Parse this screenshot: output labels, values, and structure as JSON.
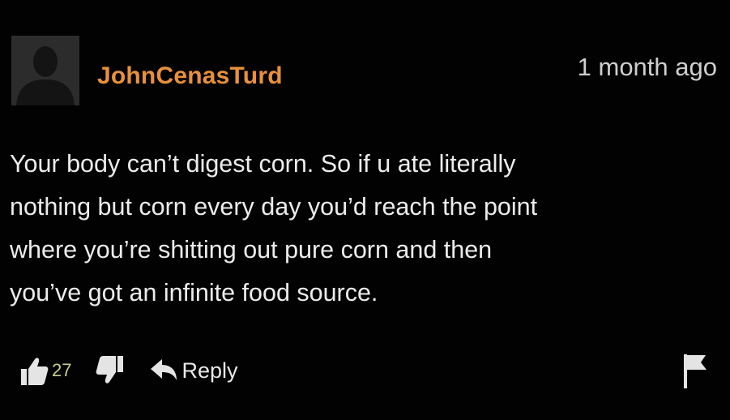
{
  "comment": {
    "username": "JohnCenasTurd",
    "timestamp": "1 month ago",
    "lines": [
      "Your body can’t digest corn. So if u ate literally",
      "nothing but corn every day you’d reach the point",
      "where you’re shitting out pure corn and then",
      "you’ve got an infinite food source."
    ],
    "likes": "27",
    "reply_label": "Reply"
  },
  "colors": {
    "background": "#020202",
    "username": "#e8913a",
    "text": "#ececec",
    "like_count": "#c6d08a",
    "icons": "#e4e4e4"
  },
  "icons": {
    "avatar": "default-user-silhouette",
    "like": "thumbs-up-icon",
    "dislike": "thumbs-down-icon",
    "reply": "reply-arrow-icon",
    "flag": "flag-icon"
  }
}
